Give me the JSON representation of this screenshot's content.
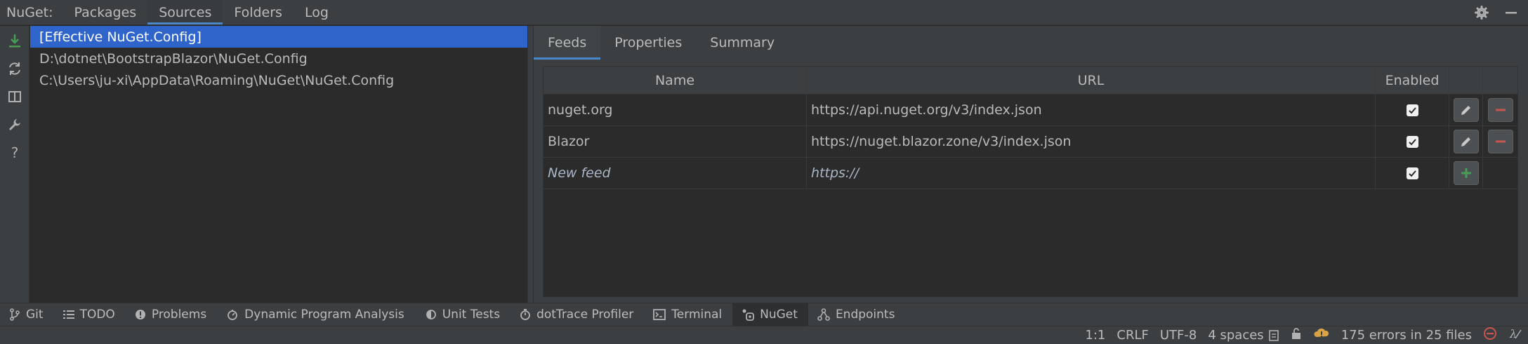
{
  "window": {
    "title": "NuGet:",
    "tabs": [
      "Packages",
      "Sources",
      "Folders",
      "Log"
    ],
    "active_tab": "Sources"
  },
  "left_toolbar": {
    "icons": [
      "download-icon",
      "refresh-icon",
      "columns-icon",
      "wrench-icon",
      "help-icon"
    ]
  },
  "sources": {
    "items": [
      "[Effective NuGet.Config]",
      "D:\\dotnet\\BootstrapBlazor\\NuGet.Config",
      "C:\\Users\\ju-xi\\AppData\\Roaming\\NuGet\\NuGet.Config"
    ],
    "selected_index": 0
  },
  "detail": {
    "tabs": [
      "Feeds",
      "Properties",
      "Summary"
    ],
    "active_tab": "Feeds",
    "table": {
      "columns": [
        "Name",
        "URL",
        "Enabled"
      ],
      "rows": [
        {
          "name": "nuget.org",
          "url": "https://api.nuget.org/v3/index.json",
          "enabled": true
        },
        {
          "name": "Blazor",
          "url": "https://nuget.blazor.zone/v3/index.json",
          "enabled": true
        }
      ],
      "new_row": {
        "name": "New feed",
        "url": "https://",
        "enabled": true
      }
    }
  },
  "tool_windows": [
    {
      "label": "Git",
      "icon": "git-branch-icon"
    },
    {
      "label": "TODO",
      "icon": "list-icon"
    },
    {
      "label": "Problems",
      "icon": "problems-icon"
    },
    {
      "label": "Dynamic Program Analysis",
      "icon": "dpa-icon"
    },
    {
      "label": "Unit Tests",
      "icon": "unit-tests-icon"
    },
    {
      "label": "dotTrace Profiler",
      "icon": "stopwatch-icon"
    },
    {
      "label": "Terminal",
      "icon": "terminal-icon"
    },
    {
      "label": "NuGet",
      "icon": "nuget-icon"
    },
    {
      "label": "Endpoints",
      "icon": "endpoints-icon"
    }
  ],
  "active_tool_window": "NuGet",
  "status_bar": {
    "position": "1:1",
    "line_separator": "CRLF",
    "encoding": "UTF-8",
    "indent": "4 spaces",
    "errors": "175 errors in 25 files"
  },
  "colors": {
    "accent": "#4a88c7",
    "selection": "#2f65ca",
    "remove": "#c75450",
    "add": "#499c54",
    "panel": "#3c3f41",
    "editor_bg": "#2b2b2b"
  }
}
